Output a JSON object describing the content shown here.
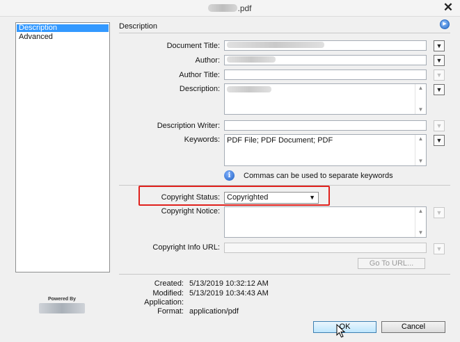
{
  "window": {
    "title_suffix": ".pdf",
    "close_glyph": "✕"
  },
  "sidebar": {
    "items": [
      {
        "label": "Description",
        "selected": true
      },
      {
        "label": "Advanced",
        "selected": false
      }
    ],
    "powered_by": "Powered By"
  },
  "description": {
    "section_title": "Description",
    "fields": {
      "document_title": {
        "label": "Document Title:"
      },
      "author": {
        "label": "Author:"
      },
      "author_title": {
        "label": "Author Title:"
      },
      "description": {
        "label": "Description:"
      },
      "description_writer": {
        "label": "Description Writer:"
      },
      "keywords": {
        "label": "Keywords:",
        "value": "PDF File; PDF Document; PDF"
      }
    },
    "keywords_hint": "Commas can be used to separate keywords",
    "copyright_status": {
      "label": "Copyright Status:",
      "value": "Copyrighted"
    },
    "copyright_notice": {
      "label": "Copyright Notice:"
    },
    "copyright_url": {
      "label": "Copyright Info URL:"
    },
    "goto_url": "Go To URL..."
  },
  "metadata": {
    "created": {
      "label": "Created:",
      "value": "5/13/2019 10:32:12 AM"
    },
    "modified": {
      "label": "Modified:",
      "value": "5/13/2019 10:34:43 AM"
    },
    "application": {
      "label": "Application:",
      "value": ""
    },
    "format": {
      "label": "Format:",
      "value": "application/pdf"
    }
  },
  "buttons": {
    "ok": "OK",
    "cancel": "Cancel"
  },
  "icons": {
    "dropdown": "▼",
    "scroll_up": "▲",
    "scroll_down": "▼",
    "info": "i",
    "nav": "▶"
  },
  "colors": {
    "selection": "#3399ff",
    "highlight_box": "#e0201c",
    "info_icon": "#1f5fbf"
  }
}
